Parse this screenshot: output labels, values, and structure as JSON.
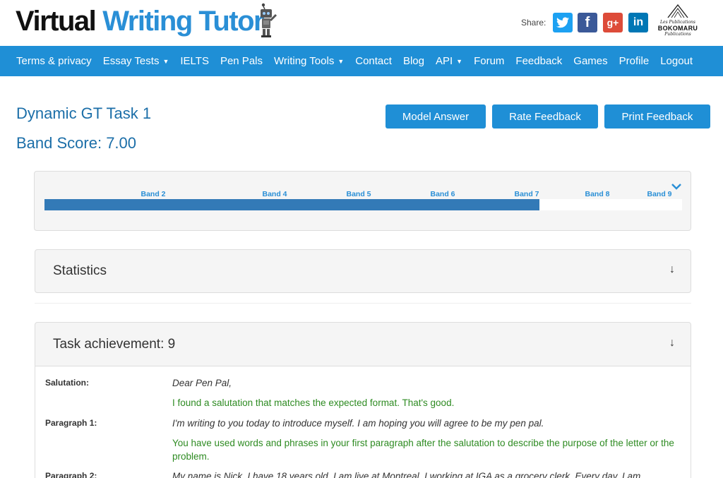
{
  "header": {
    "logo_word1": "Virtual",
    "logo_word2": "Writing Tutor",
    "share_label": "Share:",
    "social": [
      {
        "name": "twitter",
        "glyph": "t",
        "color": "#1da1f2"
      },
      {
        "name": "facebook",
        "glyph": "f",
        "color": "#3b5998"
      },
      {
        "name": "google-plus",
        "glyph": "g+",
        "color": "#dd4b39"
      },
      {
        "name": "linkedin",
        "glyph": "in",
        "color": "#0077b5"
      }
    ],
    "publisher": {
      "line1": "Les Publications",
      "line2": "BOKOMARU",
      "line3": "Publications"
    }
  },
  "nav": {
    "items": [
      {
        "label": "Terms & privacy"
      },
      {
        "label": "Essay Tests",
        "dropdown": true
      },
      {
        "label": "IELTS"
      },
      {
        "label": "Pen Pals"
      },
      {
        "label": "Writing Tools",
        "dropdown": true
      },
      {
        "label": "Contact"
      },
      {
        "label": "Blog"
      },
      {
        "label": "API",
        "dropdown": true
      },
      {
        "label": "Forum"
      },
      {
        "label": "Feedback"
      },
      {
        "label": "Games"
      },
      {
        "label": "Profile"
      },
      {
        "label": "Logout"
      }
    ]
  },
  "page": {
    "title": "Dynamic GT Task 1",
    "band_score": "Band Score: 7.00"
  },
  "buttons": {
    "model_answer": "Model Answer",
    "rate_feedback": "Rate Feedback",
    "print_feedback": "Print Feedback"
  },
  "band_bar": {
    "labels": [
      "Band 2",
      "Band 4",
      "Band 5",
      "Band 6",
      "Band 7",
      "Band 8",
      "Band 9"
    ],
    "score": 7.0
  },
  "statistics": {
    "title": "Statistics",
    "arrow": "↓"
  },
  "task_achievement": {
    "title": "Task achievement: 9",
    "arrow": "↓",
    "rows": [
      {
        "label": "Salutation:",
        "text": "Dear Pen Pal,",
        "feedback": "I found a salutation that matches the expected format. That's good."
      },
      {
        "label": "Paragraph 1:",
        "text": "I'm writing to you today to introduce myself. I am hoping you will agree to be my pen pal.",
        "feedback": "You have used words and phrases in your first paragraph after the salutation to describe the purpose of the letter or the problem."
      },
      {
        "label": "Paragraph 2:",
        "text": "My name is Nick, I have 18 years old, I am live at Montreal, I working at IGA as a grocery clerk. Every day, I am"
      }
    ]
  },
  "colors": {
    "brand_blue": "#1f8fd6",
    "title_blue": "#1b6ea8",
    "bar_fill": "#337ab7",
    "feedback_green": "#2e8b22"
  }
}
